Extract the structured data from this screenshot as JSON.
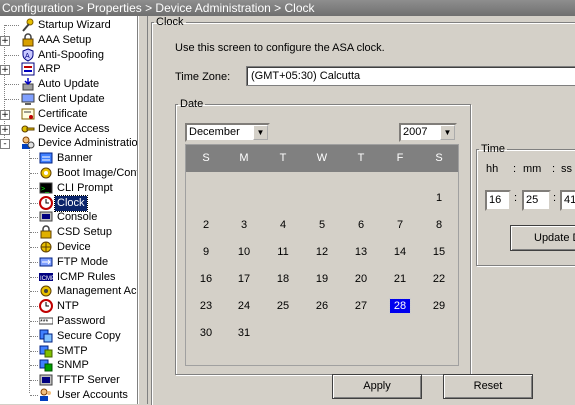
{
  "breadcrumb": "Configuration > Properties > Device Administration > Clock",
  "tree": {
    "items": [
      {
        "label": "Startup Wizard",
        "icon": "wand-icon",
        "expander": ""
      },
      {
        "label": "AAA Setup",
        "icon": "lock-icon",
        "expander": "+"
      },
      {
        "label": "Anti-Spoofing",
        "icon": "shield-icon",
        "expander": ""
      },
      {
        "label": "ARP",
        "icon": "arp-icon",
        "expander": "+"
      },
      {
        "label": "Auto Update",
        "icon": "update-icon",
        "expander": ""
      },
      {
        "label": "Client Update",
        "icon": "client-icon",
        "expander": ""
      },
      {
        "label": "Certificate",
        "icon": "certificate-icon",
        "expander": "+"
      },
      {
        "label": "Device Access",
        "icon": "key-icon",
        "expander": "+"
      },
      {
        "label": "Device Administration",
        "icon": "admin-icon",
        "expander": "-"
      }
    ],
    "children": [
      {
        "label": "Banner",
        "icon": "banner-icon"
      },
      {
        "label": "Boot Image/Configuration",
        "icon": "boot-icon"
      },
      {
        "label": "CLI Prompt",
        "icon": "cli-icon"
      },
      {
        "label": "Clock",
        "icon": "clock-icon"
      },
      {
        "label": "Console",
        "icon": "console-icon"
      },
      {
        "label": "CSD Setup",
        "icon": "csd-icon"
      },
      {
        "label": "Device",
        "icon": "device-icon"
      },
      {
        "label": "FTP Mode",
        "icon": "ftp-icon"
      },
      {
        "label": "ICMP Rules",
        "icon": "icmp-icon"
      },
      {
        "label": "Management Access",
        "icon": "management-icon"
      },
      {
        "label": "NTP",
        "icon": "ntp-icon"
      },
      {
        "label": "Password",
        "icon": "password-icon"
      },
      {
        "label": "Secure Copy",
        "icon": "secure-copy-icon"
      },
      {
        "label": "SMTP",
        "icon": "smtp-icon"
      },
      {
        "label": "SNMP",
        "icon": "snmp-icon"
      },
      {
        "label": "TFTP Server",
        "icon": "tftp-icon"
      },
      {
        "label": "User Accounts",
        "icon": "users-icon"
      }
    ],
    "selected": "Clock"
  },
  "clock": {
    "group_title": "Clock",
    "description": "Use this screen to configure the ASA clock.",
    "timezone_label": "Time Zone:",
    "timezone_value": "(GMT+05:30) Calcutta",
    "date_group_title": "Date",
    "month": "December",
    "year": "2007",
    "weekdays": [
      "S",
      "M",
      "T",
      "W",
      "T",
      "F",
      "S"
    ],
    "weeks": [
      [
        "",
        "",
        "",
        "",
        "",
        "",
        "1"
      ],
      [
        "2",
        "3",
        "4",
        "5",
        "6",
        "7",
        "8"
      ],
      [
        "9",
        "10",
        "11",
        "12",
        "13",
        "14",
        "15"
      ],
      [
        "16",
        "17",
        "18",
        "19",
        "20",
        "21",
        "22"
      ],
      [
        "23",
        "24",
        "25",
        "26",
        "27",
        "28",
        "29"
      ],
      [
        "30",
        "31",
        "",
        "",
        "",
        "",
        ""
      ]
    ],
    "selected_day": "28",
    "time_group_title": "Time",
    "hh_label": "hh",
    "mm_label": "mm",
    "ss_label": "ss",
    "colon": ":",
    "hh": "16",
    "mm": "25",
    "ss": "41",
    "update_label": "Update D"
  },
  "buttons": {
    "apply": "Apply",
    "reset": "Reset"
  }
}
